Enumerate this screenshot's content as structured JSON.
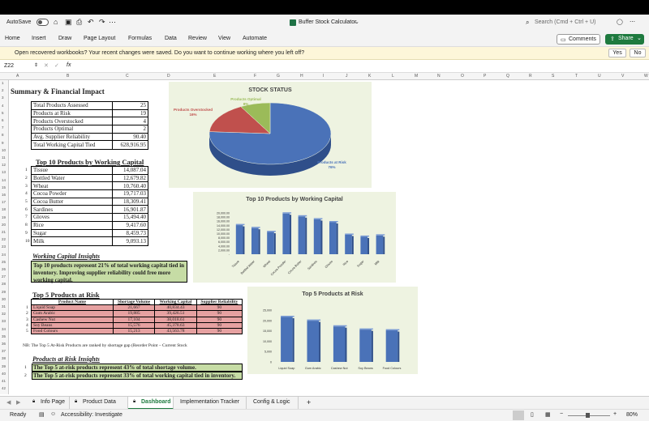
{
  "app": {
    "autosave_label": "AutoSave",
    "title": "Buffer Stock Calculator",
    "search_placeholder": "Search (Cmd + Ctrl + U)"
  },
  "ribbon": {
    "tabs": [
      "Home",
      "Insert",
      "Draw",
      "Page Layout",
      "Formulas",
      "Data",
      "Review",
      "View",
      "Automate"
    ],
    "comments_label": "Comments",
    "share_label": "Share"
  },
  "infobar": {
    "message": "Open recovered workbooks?  Your recent changes were saved. Do you want to continue working where you left off?",
    "yes_label": "Yes",
    "no_label": "No"
  },
  "formula_bar": {
    "cell_ref": "Z22",
    "fx_label": "fx",
    "value": ""
  },
  "columns": [
    "A",
    "B",
    "C",
    "D",
    "E",
    "F",
    "G",
    "H",
    "I",
    "J",
    "K",
    "L",
    "M",
    "N",
    "O",
    "P",
    "Q",
    "R",
    "S",
    "T",
    "U",
    "V",
    "W"
  ],
  "summary": {
    "title": "Summary & Financial Impact",
    "rows": [
      {
        "label": "Total Products Assessed",
        "value": "25"
      },
      {
        "label": "Products at Risk",
        "value": "19"
      },
      {
        "label": "Products Overstocked",
        "value": "4"
      },
      {
        "label": "Products Optimal",
        "value": "2"
      },
      {
        "label": "Avg. Supplier Reliability",
        "value": "90.40"
      },
      {
        "label": "Total Working Capital Tied",
        "value": "628,916.95"
      }
    ]
  },
  "top10": {
    "title": "Top 10 Products by Working Capital",
    "rows": [
      {
        "rank": "1",
        "name": "Tissue",
        "value": "14,087.04"
      },
      {
        "rank": "2",
        "name": "Bottled Water",
        "value": "12,679.82"
      },
      {
        "rank": "3",
        "name": "Wheat",
        "value": "10,760.40"
      },
      {
        "rank": "4",
        "name": "Cocoa Powder",
        "value": "19,717.03"
      },
      {
        "rank": "5",
        "name": "Cocoa Butter",
        "value": "18,309.41"
      },
      {
        "rank": "6",
        "name": "Sardines",
        "value": "16,901.87"
      },
      {
        "rank": "7",
        "name": "Gloves",
        "value": "15,494.40"
      },
      {
        "rank": "8",
        "name": "Rice",
        "value": "9,417.60"
      },
      {
        "rank": "9",
        "name": "Sugar",
        "value": "8,459.73"
      },
      {
        "rank": "10",
        "name": "Milk",
        "value": "9,093.13"
      }
    ]
  },
  "wc_insights": {
    "title": "Working Capital Insights",
    "text": "Top 10 products represent 21% of total working capital tied in inventory. Improving supplier reliability could free more working capital."
  },
  "top5": {
    "title": "Top 5 Products at Risk",
    "headers": [
      "Product Name",
      "Shortage Volume",
      "Working Capital",
      "Supplier Reliability"
    ],
    "rows": [
      {
        "rank": "1",
        "name": "Liquid Soap",
        "shortage": "21,667",
        "capital": "40,834.43",
        "rel": "90"
      },
      {
        "rank": "2",
        "name": "Gum Arabic",
        "shortage": "19,885",
        "capital": "39,426.51",
        "rel": "90"
      },
      {
        "rank": "3",
        "name": "Cashew Nut",
        "shortage": "17,104",
        "capital": "38,018.61",
        "rel": "90"
      },
      {
        "rank": "4",
        "name": "Soy Beans",
        "shortage": "15,576",
        "capital": "45,378.63",
        "rel": "90"
      },
      {
        "rank": "5",
        "name": "Food Colours",
        "shortage": "15,213",
        "capital": "43,563.78",
        "rel": "90"
      }
    ],
    "note": "NB: The Top 5 At-Risk Products are ranked by shortage gap (Reorder Point – Current Stock"
  },
  "risk_insights": {
    "title": "Products at Risk Insights",
    "lines": [
      {
        "n": "1",
        "text": "The Top 5 at-risk products represent 43% of total shortage volume."
      },
      {
        "n": "2",
        "text": "The Top 5 at-risk products represent 33% of total working capital tied in inventory."
      }
    ]
  },
  "chart_data": [
    {
      "type": "pie",
      "title": "STOCK STATUS",
      "categories": [
        "Products at Risk",
        "Products Overstocked",
        "Products Optimal"
      ],
      "values": [
        76,
        16,
        8
      ],
      "labels": [
        "Products at Risk\n76%",
        "Products Overstocked\n16%",
        "Products Optimal\n8%"
      ],
      "colors": [
        "#4a72b8",
        "#c0504d",
        "#9bbb59"
      ]
    },
    {
      "type": "bar",
      "title": "Top 10 Products by Working Capital",
      "categories": [
        "Tissue",
        "Bottled Water",
        "Wheat",
        "Cocoa Powder",
        "Cocoa Butter",
        "Sardines",
        "Gloves",
        "Rice",
        "Sugar",
        "Milk"
      ],
      "values": [
        14087.04,
        12679.82,
        10760.4,
        19717.03,
        18309.41,
        16901.87,
        15494.4,
        9417.6,
        8459.73,
        9093.13
      ],
      "ylim": [
        0,
        20000
      ],
      "yticks": [
        "20,000.00",
        "18,000.00",
        "16,000.00",
        "14,000.00",
        "12,000.00",
        "10,000.00",
        "8,000.00",
        "6,000.00",
        "4,000.00",
        "2,000.00",
        "-"
      ],
      "color": "#4a72b8"
    },
    {
      "type": "bar",
      "title": "Top 5 Products at Risk",
      "categories": [
        "Liquid Soap",
        "Gum Arabic",
        "Cashew Nut",
        "Soy Beans",
        "Food Colours"
      ],
      "values": [
        21667,
        19885,
        17104,
        15576,
        15213
      ],
      "ylim": [
        0,
        25000
      ],
      "yticks": [
        "25,000",
        "20,000",
        "15,000",
        "10,000",
        "5,000",
        "0"
      ],
      "color": "#4a72b8"
    }
  ],
  "sheet_tabs": [
    "Info Page",
    "Product Data",
    "Dashboard",
    "Implementation Tracker",
    "Config & Logic"
  ],
  "active_tab": "Dashboard",
  "status": {
    "ready": "Ready",
    "accessibility": "Accessibility: Investigate",
    "zoom": "80%"
  }
}
